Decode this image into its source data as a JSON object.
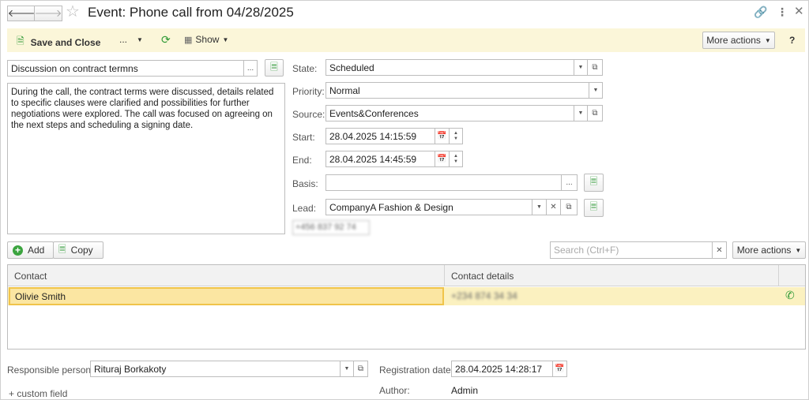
{
  "window": {
    "title": "Event: Phone call from 04/28/2025"
  },
  "toolbar": {
    "save_close": "Save and Close",
    "more_menu": "...",
    "show": "Show",
    "more_actions": "More actions",
    "help": "?"
  },
  "subject": {
    "value": "Discussion on contract termns",
    "select_btn": "..."
  },
  "description": "During the call, the contract terms were discussed, details related to specific clauses were clarified and possibilities for further negotiations were explored. The call was focused on agreeing on the next steps and scheduling a signing date.",
  "form": {
    "state_label": "State:",
    "state_value": "Scheduled",
    "priority_label": "Priority:",
    "priority_value": "Normal",
    "source_label": "Source:",
    "source_value": "Events&Conferences",
    "start_label": "Start:",
    "start_value": "28.04.2025 14:15:59",
    "end_label": "End:",
    "end_value": "28.04.2025 14:45:59",
    "basis_label": "Basis:",
    "basis_value": "",
    "basis_select": "...",
    "lead_label": "Lead:",
    "lead_value": "CompanyA Fashion & Design",
    "lead_phone": "+456 837 92 74"
  },
  "contacts_toolbar": {
    "add": "Add",
    "copy": "Copy",
    "search_placeholder": "Search (Ctrl+F)",
    "more_actions": "More actions"
  },
  "table": {
    "columns": [
      "Contact",
      "Contact details"
    ],
    "rows": [
      {
        "contact": "Olivie Smith",
        "details": "+234 874 34 34"
      }
    ]
  },
  "footer": {
    "responsible_label": "Responsible person:",
    "responsible_value": "Rituraj Borkakoty",
    "registration_label": "Registration date:",
    "registration_value": "28.04.2025 14:28:17",
    "author_label": "Author:",
    "author_value": "Admin",
    "custom_field": "+ custom field"
  },
  "colors": {
    "toolbar_bg": "#fbf6d9",
    "selection": "#fbe6a2",
    "selection_border": "#f0c44a",
    "accent_green": "#2f9a36"
  }
}
